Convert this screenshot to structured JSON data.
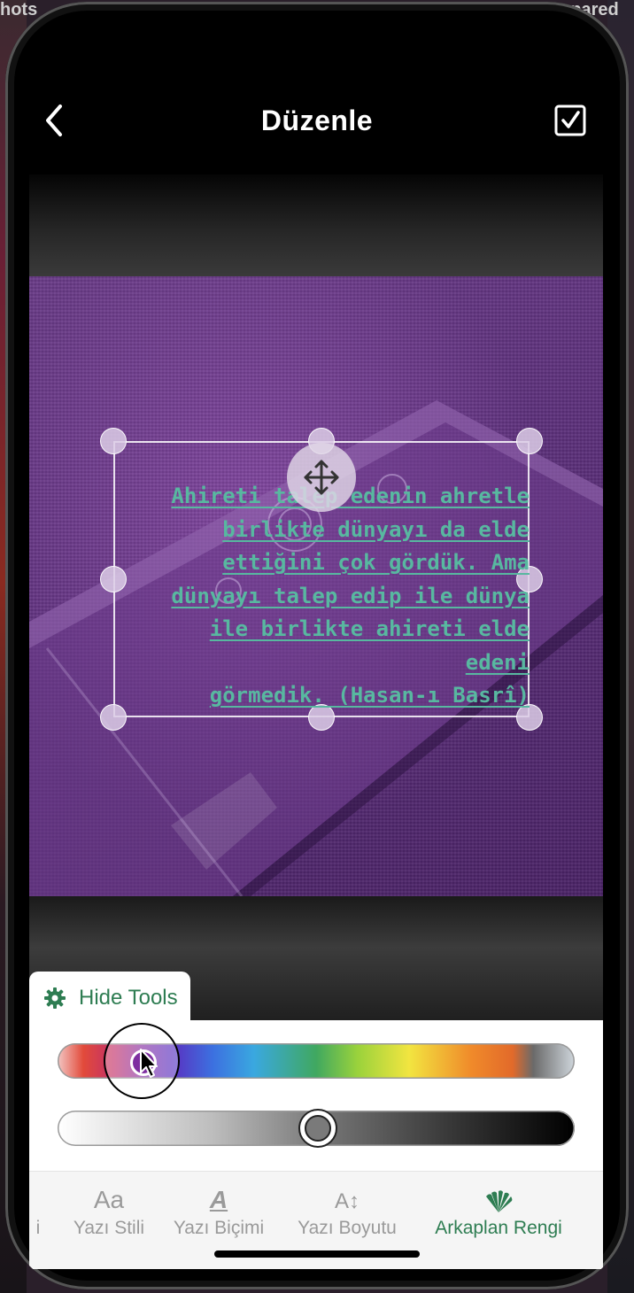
{
  "desktop": {
    "left_label": "hots",
    "right_label": "Prepared"
  },
  "header": {
    "title": "Düzenle",
    "back_icon": "chevron-left-icon",
    "confirm_icon": "checkbox-check-icon"
  },
  "editor": {
    "quote_lines": [
      "Ahireti talep edenin ahretle",
      "birlikte dünyayı da elde",
      "ettiğini çok gördük. Ama",
      "dünyayı talep edip ile dünya",
      "ile birlikte ahireti elde edeni",
      "görmedik. (Hasan-ı Basrî)"
    ],
    "text_color": "#58b8a0",
    "background_tint": "#5b2f7a"
  },
  "tools": {
    "hide_label": "Hide Tools",
    "hue_selected_color": "#7e2ea0",
    "hue_position_fraction": 0.16,
    "luminance_position_fraction": 0.5
  },
  "bottom_tabs": [
    {
      "label": "i",
      "icon": "",
      "active": false
    },
    {
      "label": "Yazı Stili",
      "icon": "Aa",
      "active": false
    },
    {
      "label": "Yazı Biçimi",
      "icon": "A",
      "active": false
    },
    {
      "label": "Yazı Boyutu",
      "icon": "A↕",
      "active": false
    },
    {
      "label": "Arkaplan Rengi",
      "icon": "fan-icon",
      "active": true
    }
  ],
  "colors": {
    "accent": "#2e7d52",
    "inactive": "#9a9a9a"
  }
}
